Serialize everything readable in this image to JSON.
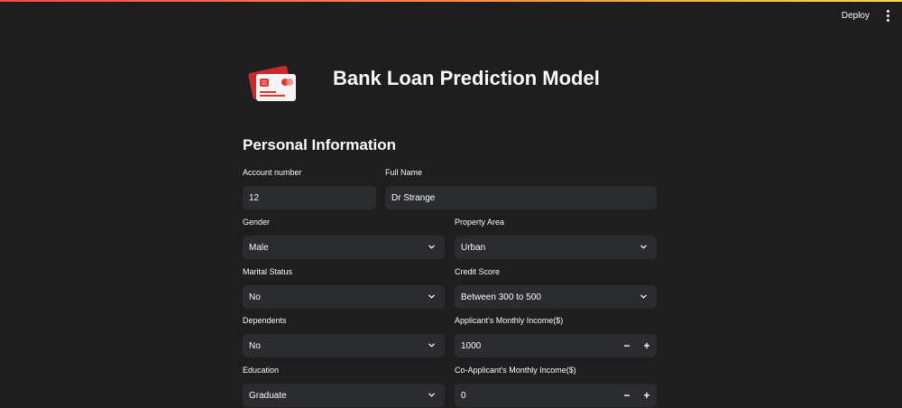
{
  "toolbar": {
    "deploy_label": "Deploy"
  },
  "header": {
    "title": "Bank Loan Prediction Model",
    "icon": "credit-card-icon"
  },
  "section": {
    "title": "Personal Information"
  },
  "fields": {
    "account_number": {
      "label": "Account number",
      "value": "12"
    },
    "full_name": {
      "label": "Full Name",
      "value": "Dr Strange"
    },
    "gender": {
      "label": "Gender",
      "value": "Male"
    },
    "property_area": {
      "label": "Property Area",
      "value": "Urban"
    },
    "marital_status": {
      "label": "Marital Status",
      "value": "No"
    },
    "credit_score": {
      "label": "Credit Score",
      "value": "Between 300 to 500"
    },
    "dependents": {
      "label": "Dependents",
      "value": "No"
    },
    "applicant_income": {
      "label": "Applicant's Monthly Income($)",
      "value": "1000"
    },
    "education": {
      "label": "Education",
      "value": "Graduate"
    },
    "coapplicant_income": {
      "label": "Co-Applicant's Monthly Income($)",
      "value": "0"
    }
  },
  "stepper": {
    "minus": "−",
    "plus": "+"
  },
  "colors": {
    "background": "#1e1e1e",
    "input": "#2b2c30",
    "accent_red": "#e5322d"
  }
}
